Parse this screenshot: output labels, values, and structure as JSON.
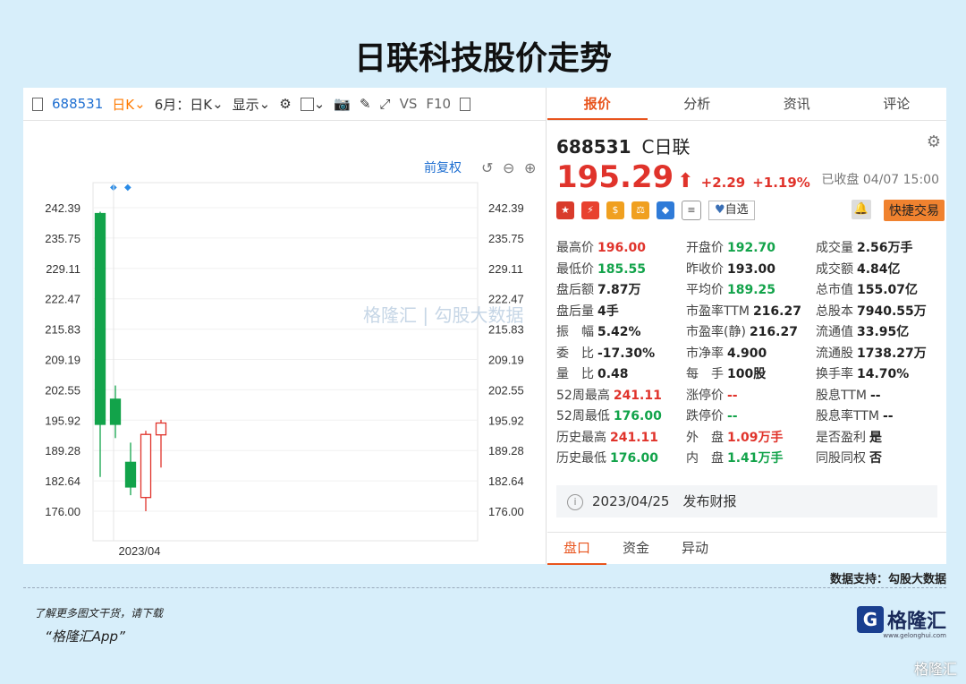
{
  "title": "日联科技股价走势",
  "toolbar": {
    "code": "688531",
    "period": "日K",
    "month_period": "6月：日K",
    "display": "显示",
    "vs": "VS",
    "f10": "F10",
    "fq": "前复权"
  },
  "chart_data": {
    "type": "candlestick",
    "y_ticks": [
      "242.39",
      "235.75",
      "229.11",
      "222.47",
      "215.83",
      "209.19",
      "202.55",
      "195.92",
      "189.28",
      "182.64",
      "176.00"
    ],
    "ylim": [
      176.0,
      242.39
    ],
    "x_label": "2023/04",
    "candles": [
      {
        "open": 195.0,
        "close": 241.11,
        "high": 241.5,
        "low": 183.5
      },
      {
        "open": 200.5,
        "close": 195.0,
        "high": 203.5,
        "low": 192.0
      },
      {
        "open": 186.7,
        "close": 181.3,
        "high": 191.0,
        "low": 179.5
      },
      {
        "open": 179.0,
        "close": 192.8,
        "high": 193.6,
        "low": 176.0
      },
      {
        "open": 192.7,
        "close": 195.29,
        "high": 196.0,
        "low": 185.55
      }
    ]
  },
  "tabs": [
    "报价",
    "分析",
    "资讯",
    "评论"
  ],
  "stock": {
    "code": "688531",
    "name": "C日联",
    "price": "195.29",
    "change": "+2.29",
    "pct": "+1.19%",
    "status": "已收盘 04/07 15:00",
    "zixuan": "自选",
    "fast_trade": "快捷交易"
  },
  "quote_rows": [
    [
      {
        "l": "最高价",
        "v": "196.00",
        "c": "red"
      },
      {
        "l": "开盘价",
        "v": "192.70",
        "c": "grn"
      },
      {
        "l": "成交量",
        "v": "2.56万手",
        "c": "blk"
      }
    ],
    [
      {
        "l": "最低价",
        "v": "185.55",
        "c": "grn"
      },
      {
        "l": "昨收价",
        "v": "193.00",
        "c": "blk"
      },
      {
        "l": "成交额",
        "v": "4.84亿",
        "c": "blk"
      }
    ],
    [
      {
        "l": "盘后额",
        "v": "7.87万",
        "c": "blk"
      },
      {
        "l": "平均价",
        "v": "189.25",
        "c": "grn"
      },
      {
        "l": "总市值",
        "v": "155.07亿",
        "c": "blk"
      }
    ],
    [
      {
        "l": "盘后量",
        "v": "4手",
        "c": "blk"
      },
      {
        "l": "市盈率TTM",
        "v": "216.27",
        "c": "blk"
      },
      {
        "l": "总股本",
        "v": "7940.55万",
        "c": "blk"
      }
    ],
    [
      {
        "l": "振　幅",
        "v": "5.42%",
        "c": "blk"
      },
      {
        "l": "市盈率(静)",
        "v": "216.27",
        "c": "blk"
      },
      {
        "l": "流通值",
        "v": "33.95亿",
        "c": "blk"
      }
    ],
    [
      {
        "l": "委　比",
        "v": "-17.30%",
        "c": "blk"
      },
      {
        "l": "市净率",
        "v": "4.900",
        "c": "blk"
      },
      {
        "l": "流通股",
        "v": "1738.27万",
        "c": "blk"
      }
    ],
    [
      {
        "l": "量　比",
        "v": "0.48",
        "c": "blk"
      },
      {
        "l": "每　手",
        "v": "100股",
        "c": "blk"
      },
      {
        "l": "换手率",
        "v": "14.70%",
        "c": "blk"
      }
    ],
    [
      {
        "l": "52周最高",
        "v": "241.11",
        "c": "red"
      },
      {
        "l": "涨停价",
        "v": "--",
        "c": "red"
      },
      {
        "l": "股息TTM",
        "v": "--",
        "c": "blk"
      }
    ],
    [
      {
        "l": "52周最低",
        "v": "176.00",
        "c": "grn"
      },
      {
        "l": "跌停价",
        "v": "--",
        "c": "grn"
      },
      {
        "l": "股息率TTM",
        "v": "--",
        "c": "blk"
      }
    ],
    [
      {
        "l": "历史最高",
        "v": "241.11",
        "c": "red"
      },
      {
        "l": "外　盘",
        "v": "1.09万手",
        "c": "red"
      },
      {
        "l": "是否盈利",
        "v": "是",
        "c": "blk"
      }
    ],
    [
      {
        "l": "历史最低",
        "v": "176.00",
        "c": "grn"
      },
      {
        "l": "内　盘",
        "v": "1.41万手",
        "c": "grn"
      },
      {
        "l": "同股同权",
        "v": "否",
        "c": "blk"
      }
    ]
  ],
  "report": {
    "date": "2023/04/25",
    "text": "发布财报"
  },
  "bottom_tabs": [
    "盘口",
    "资金",
    "异动"
  ],
  "support": "数据支持：勾股大数据",
  "promo": {
    "line1": "了解更多图文干货，请下载",
    "line2": "“格隆汇App”"
  },
  "logo": {
    "text": "格隆汇",
    "sub": "www.gelonghui.com"
  },
  "watermark": "格隆汇 | 勾股大数据"
}
